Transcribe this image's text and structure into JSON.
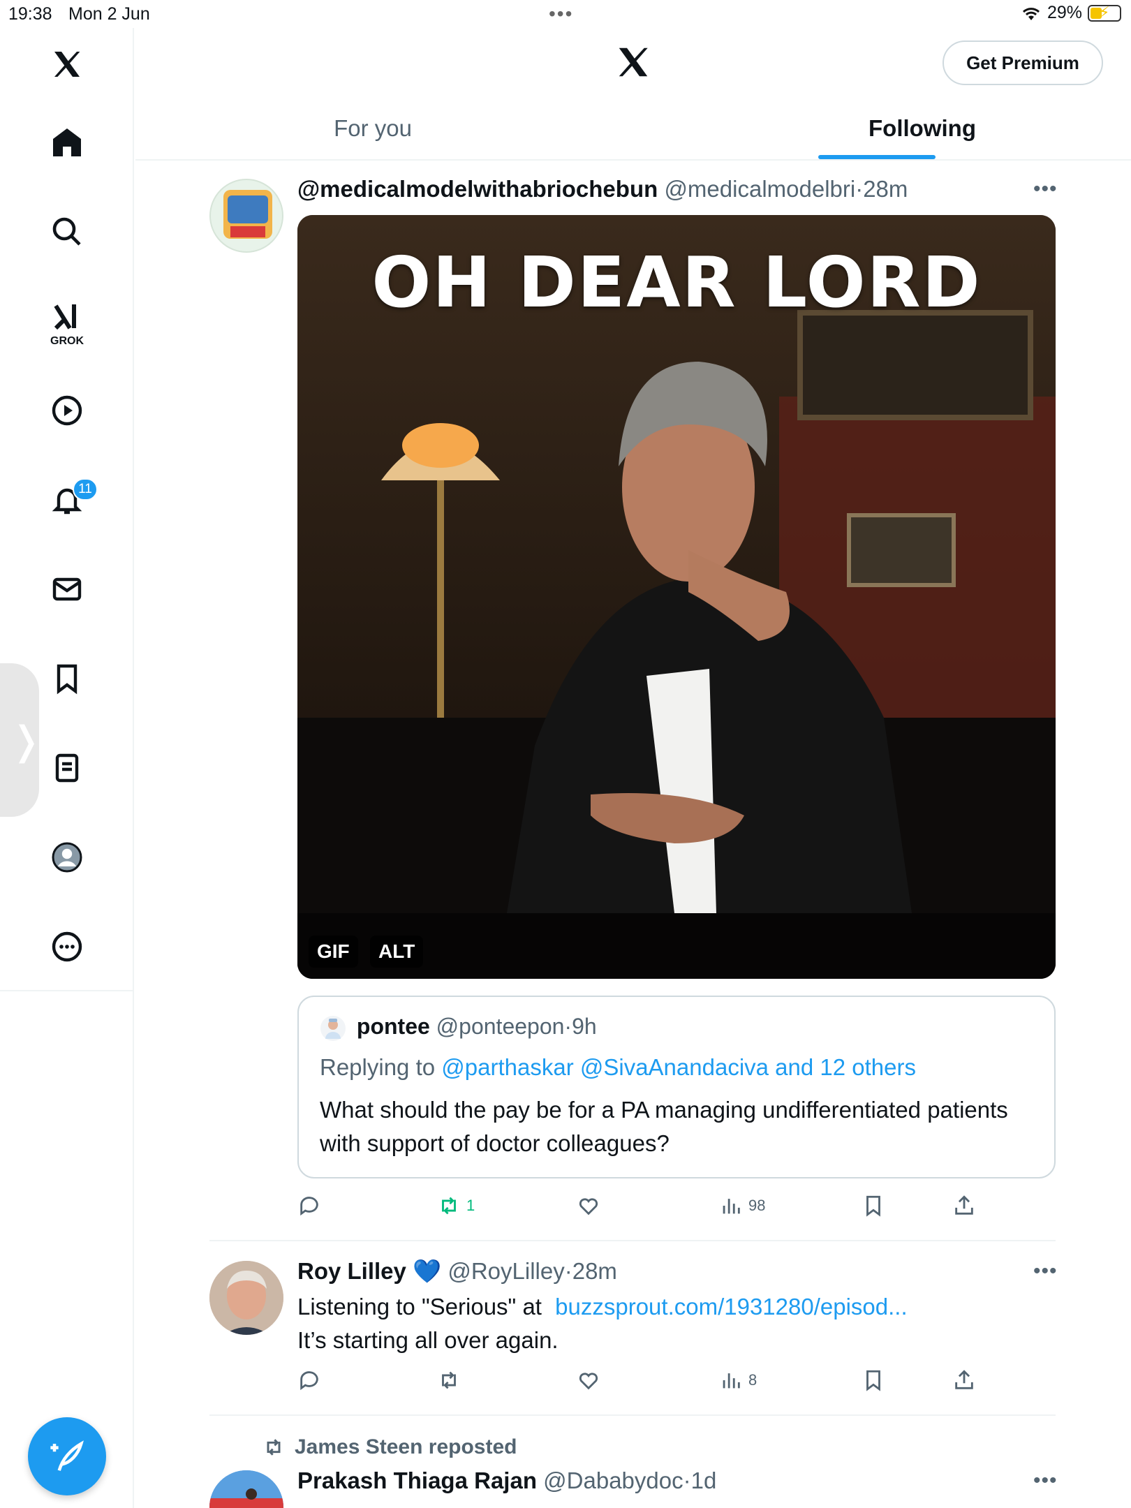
{
  "status": {
    "time": "19:38",
    "date": "Mon 2 Jun",
    "battery": "29%"
  },
  "sidebar": {
    "grok_label": "GROK",
    "notifications_badge": "11"
  },
  "header": {
    "premium_label": "Get Premium"
  },
  "tabs": [
    {
      "label": "For you"
    },
    {
      "label": "Following"
    }
  ],
  "posts": [
    {
      "name": "@medicalmodelwithabriochebun",
      "handle": "@medicalmodelbri",
      "time": "28m",
      "media": {
        "overlay_text": "OH DEAR LORD",
        "gif_chip": "GIF",
        "alt_chip": "ALT"
      },
      "quote": {
        "name": "pontee",
        "handle": "@ponteepon",
        "time": "9h",
        "replying_prefix": "Replying to ",
        "replying_to": "@parthaskar @SivaAnandaciva and 12 others",
        "text": "What should the pay be for a PA managing undifferentiated patients with support of doctor colleagues?"
      },
      "actions": {
        "reposts": "1",
        "views": "98"
      }
    },
    {
      "name": "Roy Lilley",
      "handle": "@RoyLilley",
      "time": "28m",
      "text_prefix": "Listening to \"Serious\" at ",
      "link": "buzzsprout.com/1931280/episod...",
      "text_line2": "It’s starting all over again.",
      "actions": {
        "views": "8"
      }
    },
    {
      "repost_label": "James Steen reposted",
      "name": "Prakash Thiaga Rajan",
      "handle": "@Dababydoc",
      "time": "1d"
    }
  ],
  "colors": {
    "accent": "#1d9bf0",
    "repost_green": "#00ba7c",
    "muted": "#536471"
  }
}
